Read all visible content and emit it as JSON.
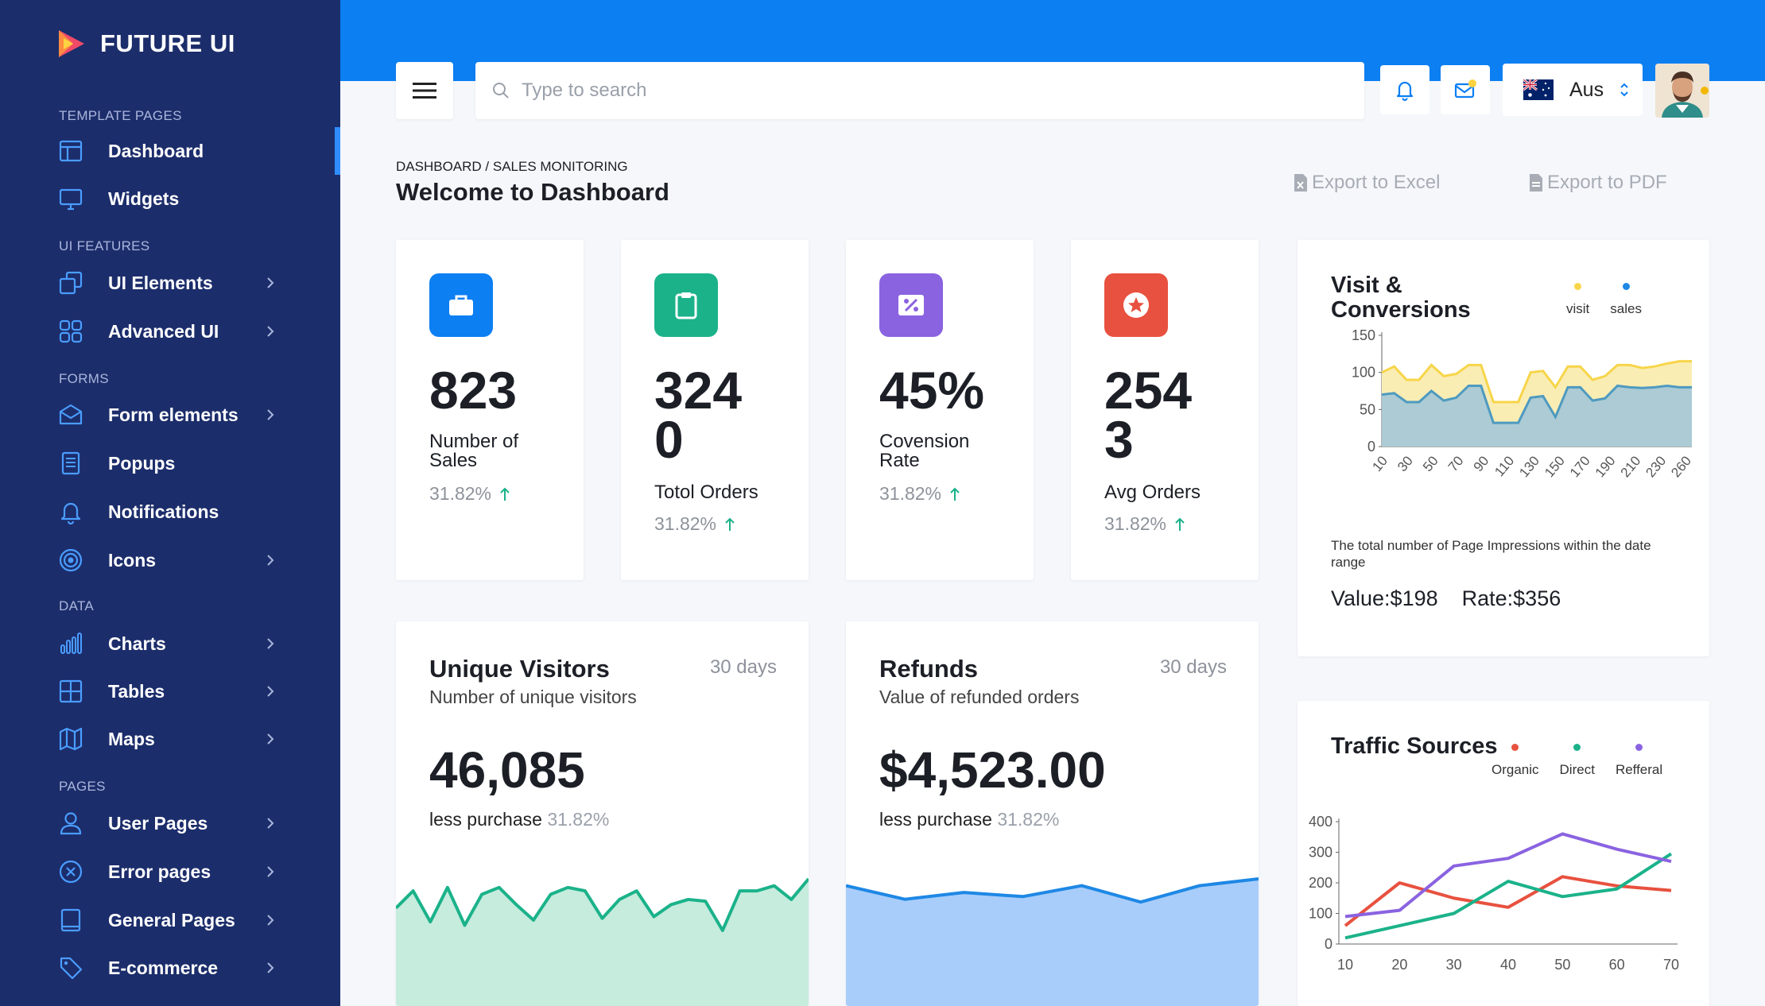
{
  "brand": {
    "name": "FUTURE UI"
  },
  "sidebar": {
    "sections": [
      {
        "label": "TEMPLATE PAGES"
      },
      {
        "label": "UI FEATURES"
      },
      {
        "label": "FORMS"
      },
      {
        "label": "DATA"
      },
      {
        "label": "PAGES"
      }
    ],
    "items": [
      {
        "label": "Dashboard",
        "icon": "layout-icon",
        "active": true
      },
      {
        "label": "Widgets",
        "icon": "monitor-icon"
      },
      {
        "label": "UI Elements",
        "icon": "copy-icon",
        "chevron": true
      },
      {
        "label": "Advanced UI",
        "icon": "grid-icon",
        "chevron": true
      },
      {
        "label": "Form elements",
        "icon": "mail-icon",
        "chevron": true
      },
      {
        "label": "Popups",
        "icon": "file-text-icon"
      },
      {
        "label": "Notifications",
        "icon": "bell-icon"
      },
      {
        "label": "Icons",
        "icon": "target-icon",
        "chevron": true
      },
      {
        "label": "Charts",
        "icon": "bar-chart-icon",
        "chevron": true
      },
      {
        "label": "Tables",
        "icon": "table-icon",
        "chevron": true
      },
      {
        "label": "Maps",
        "icon": "map-icon",
        "chevron": true
      },
      {
        "label": "User Pages",
        "icon": "user-icon",
        "chevron": true
      },
      {
        "label": "Error pages",
        "icon": "x-circle-icon",
        "chevron": true
      },
      {
        "label": "General Pages",
        "icon": "tablet-icon",
        "chevron": true
      },
      {
        "label": "E-commerce",
        "icon": "tag-icon",
        "chevron": true
      }
    ]
  },
  "header": {
    "search_placeholder": "Type to search",
    "language": "Aus"
  },
  "page": {
    "breadcrumb": "DASHBOARD / SALES MONITORING",
    "title": "Welcome to Dashboard",
    "export_excel": "Export to Excel",
    "export_pdf": "Export to PDF"
  },
  "stats": [
    {
      "value": "823",
      "label": "Number of Sales",
      "change": "31.82%",
      "color": "#0c7ff2",
      "icon": "briefcase-icon"
    },
    {
      "value": "3240",
      "label": "Totol Orders",
      "change": "31.82%",
      "color": "#1bb28a",
      "icon": "clipboard-icon"
    },
    {
      "value": "45%",
      "label": "Covension Rate",
      "change": "31.82%",
      "color": "#8a63e0",
      "icon": "percent-icon"
    },
    {
      "value": "2543",
      "label": "Avg Orders",
      "change": "31.82%",
      "color": "#e8513f",
      "icon": "star-icon"
    }
  ],
  "visitors": {
    "title": "Unique Visitors",
    "subtitle": "Number of unique visitors",
    "period": "30 days",
    "value": "46,085",
    "note": "less purchase",
    "note_pct": "31.82%"
  },
  "refunds": {
    "title": "Refunds",
    "subtitle": "Value of refunded orders",
    "period": "30 days",
    "value": "$4,523.00",
    "note": "less purchase",
    "note_pct": "31.82%"
  },
  "visit_conversions": {
    "title": "Visit & Conversions",
    "description": "The total number of Page Impressions within the date range",
    "value_text": "Value:$198",
    "rate_text": "Rate:$356"
  },
  "traffic": {
    "title": "Traffic Sources"
  },
  "chart_data": [
    {
      "type": "area",
      "title": "Visit & Conversions",
      "x": [
        10,
        20,
        30,
        40,
        50,
        60,
        70,
        80,
        90,
        100,
        110,
        120,
        130,
        140,
        150,
        160,
        170,
        180,
        190,
        200,
        210,
        220,
        230,
        240,
        250,
        260
      ],
      "x_tick_labels": [
        "10",
        "30",
        "50",
        "70",
        "90",
        "110",
        "130",
        "150",
        "170",
        "190",
        "210",
        "230",
        "260"
      ],
      "ylim": [
        0,
        150
      ],
      "y_ticks": [
        0,
        50,
        100,
        150
      ],
      "series": [
        {
          "name": "visit",
          "color": "#f7d54a",
          "values": [
            100,
            108,
            90,
            90,
            110,
            95,
            98,
            110,
            110,
            60,
            60,
            60,
            100,
            102,
            80,
            108,
            108,
            90,
            95,
            110,
            110,
            106,
            108,
            112,
            115,
            115
          ]
        },
        {
          "name": "sales",
          "color": "#1e88e5",
          "values": [
            70,
            72,
            60,
            60,
            75,
            62,
            66,
            82,
            82,
            32,
            32,
            32,
            66,
            68,
            40,
            80,
            80,
            62,
            65,
            82,
            80,
            79,
            80,
            82,
            80,
            80
          ]
        }
      ]
    },
    {
      "type": "line",
      "title": "Traffic Sources",
      "x": [
        10,
        20,
        30,
        40,
        50,
        60,
        70
      ],
      "ylim": [
        0,
        400
      ],
      "y_ticks": [
        0,
        100,
        200,
        300,
        400
      ],
      "series": [
        {
          "name": "Organic",
          "color": "#e8513f",
          "values": [
            60,
            200,
            150,
            120,
            220,
            190,
            175
          ]
        },
        {
          "name": "Direct",
          "color": "#1bb28a",
          "values": [
            20,
            60,
            100,
            205,
            155,
            180,
            295
          ]
        },
        {
          "name": "Refferal",
          "color": "#8a63e0",
          "values": [
            90,
            110,
            255,
            280,
            360,
            310,
            270
          ]
        }
      ]
    },
    {
      "type": "area",
      "title": "Unique Visitors",
      "color": "#1bb28a",
      "values": [
        20,
        30,
        12,
        32,
        10,
        28,
        32,
        22,
        13,
        28,
        32,
        30,
        14,
        25,
        30,
        15,
        22,
        25,
        24,
        7,
        30,
        30,
        33,
        25,
        37
      ]
    },
    {
      "type": "area",
      "title": "Refunds",
      "color": "#1e88e5",
      "values": [
        30,
        20,
        25,
        22,
        30,
        18,
        30,
        35
      ]
    }
  ]
}
